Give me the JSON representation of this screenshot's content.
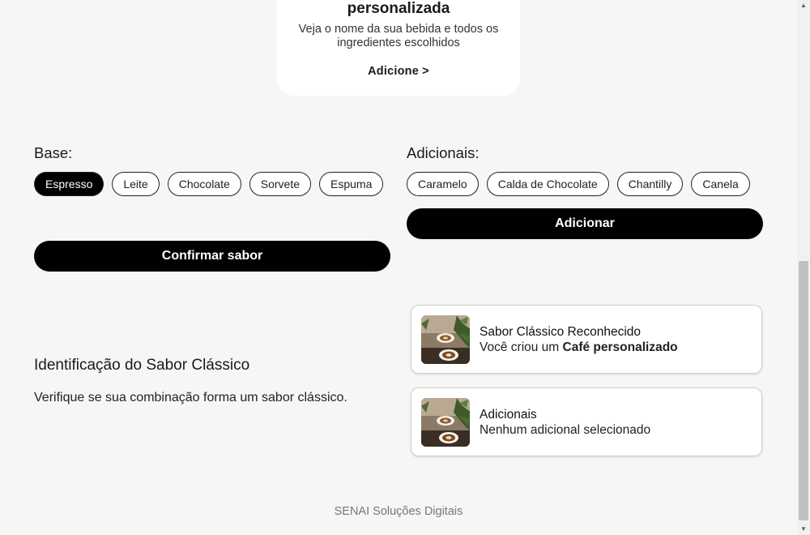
{
  "top_card": {
    "title": "personalizada",
    "description": "Veja o nome da sua bebida e todos os ingredientes escolhidos",
    "link_label": "Adicione >"
  },
  "base": {
    "label": "Base:",
    "options": [
      {
        "label": "Espresso",
        "selected": true
      },
      {
        "label": "Leite",
        "selected": false
      },
      {
        "label": "Chocolate",
        "selected": false
      },
      {
        "label": "Sorvete",
        "selected": false
      },
      {
        "label": "Espuma",
        "selected": false
      }
    ],
    "confirm_label": "Confirmar sabor"
  },
  "adicionais": {
    "label": "Adicionais:",
    "options": [
      {
        "label": "Caramelo",
        "selected": false
      },
      {
        "label": "Calda de Chocolate",
        "selected": false
      },
      {
        "label": "Chantilly",
        "selected": false
      },
      {
        "label": "Canela",
        "selected": false
      }
    ],
    "add_label": "Adicionar"
  },
  "identification": {
    "title": "Identificação do Sabor Clássico",
    "description": "Verifique se sua combinação forma um sabor clássico."
  },
  "results": [
    {
      "title": "Sabor Clássico Reconhecido",
      "text_prefix": "Você criou um ",
      "text_bold": "Café personalizado"
    },
    {
      "title": "Adicionais",
      "text_prefix": "Nenhum adicional selecionado",
      "text_bold": ""
    }
  ],
  "footer": {
    "text": "SENAI Soluções Digitais"
  },
  "colors": {
    "background": "#f7f6f5",
    "primary": "#000000",
    "card": "#ffffff"
  }
}
